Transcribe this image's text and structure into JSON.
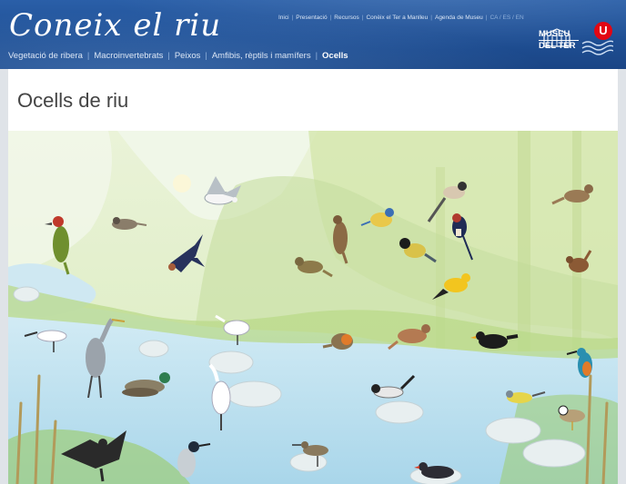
{
  "header": {
    "site_title": "Coneix el riu",
    "top_nav": [
      "Inici",
      "Presentació",
      "Recursos",
      "Conèix el Ter a Manlleu",
      "Agenda de Museu"
    ],
    "languages": "CA / ES / EN",
    "sub_nav": [
      {
        "label": "Vegetació de ribera",
        "active": false
      },
      {
        "label": "Macroinvertebrats",
        "active": false
      },
      {
        "label": "Peixos",
        "active": false
      },
      {
        "label": "Amfibis, rèptils i mamífers",
        "active": false
      },
      {
        "label": "Ocells",
        "active": true
      }
    ],
    "museum_logo": {
      "line1": "MUSEU",
      "line2_a": "DEL",
      "line2_b": "TER"
    },
    "university_logo": "U"
  },
  "page": {
    "title": "Ocells de riu"
  },
  "colors": {
    "header_blue": "#1f4f94",
    "active_link": "#ffffff",
    "title_text": "#444444",
    "water": "#bfe0ef",
    "vegetation": "#cfe3a6"
  },
  "scene": {
    "birds": [
      "green-woodpecker",
      "grey-wagtail-perched",
      "sun",
      "seagull",
      "swallow-flying",
      "song-thrush",
      "blue-tit",
      "long-tailed-bird",
      "barn-swallow",
      "great-tit",
      "nightingale",
      "golden-oriole",
      "wren",
      "flycatcher",
      "little-egret-left",
      "grey-heron",
      "mallard",
      "little-egret",
      "robin",
      "common-redstart",
      "blackbird",
      "kingfisher",
      "white-wagtail",
      "grey-wagtail",
      "little-ringed-plover",
      "cormorant",
      "black-crowned-bird",
      "sandpiper",
      "moorhen",
      "egret-standing"
    ]
  }
}
